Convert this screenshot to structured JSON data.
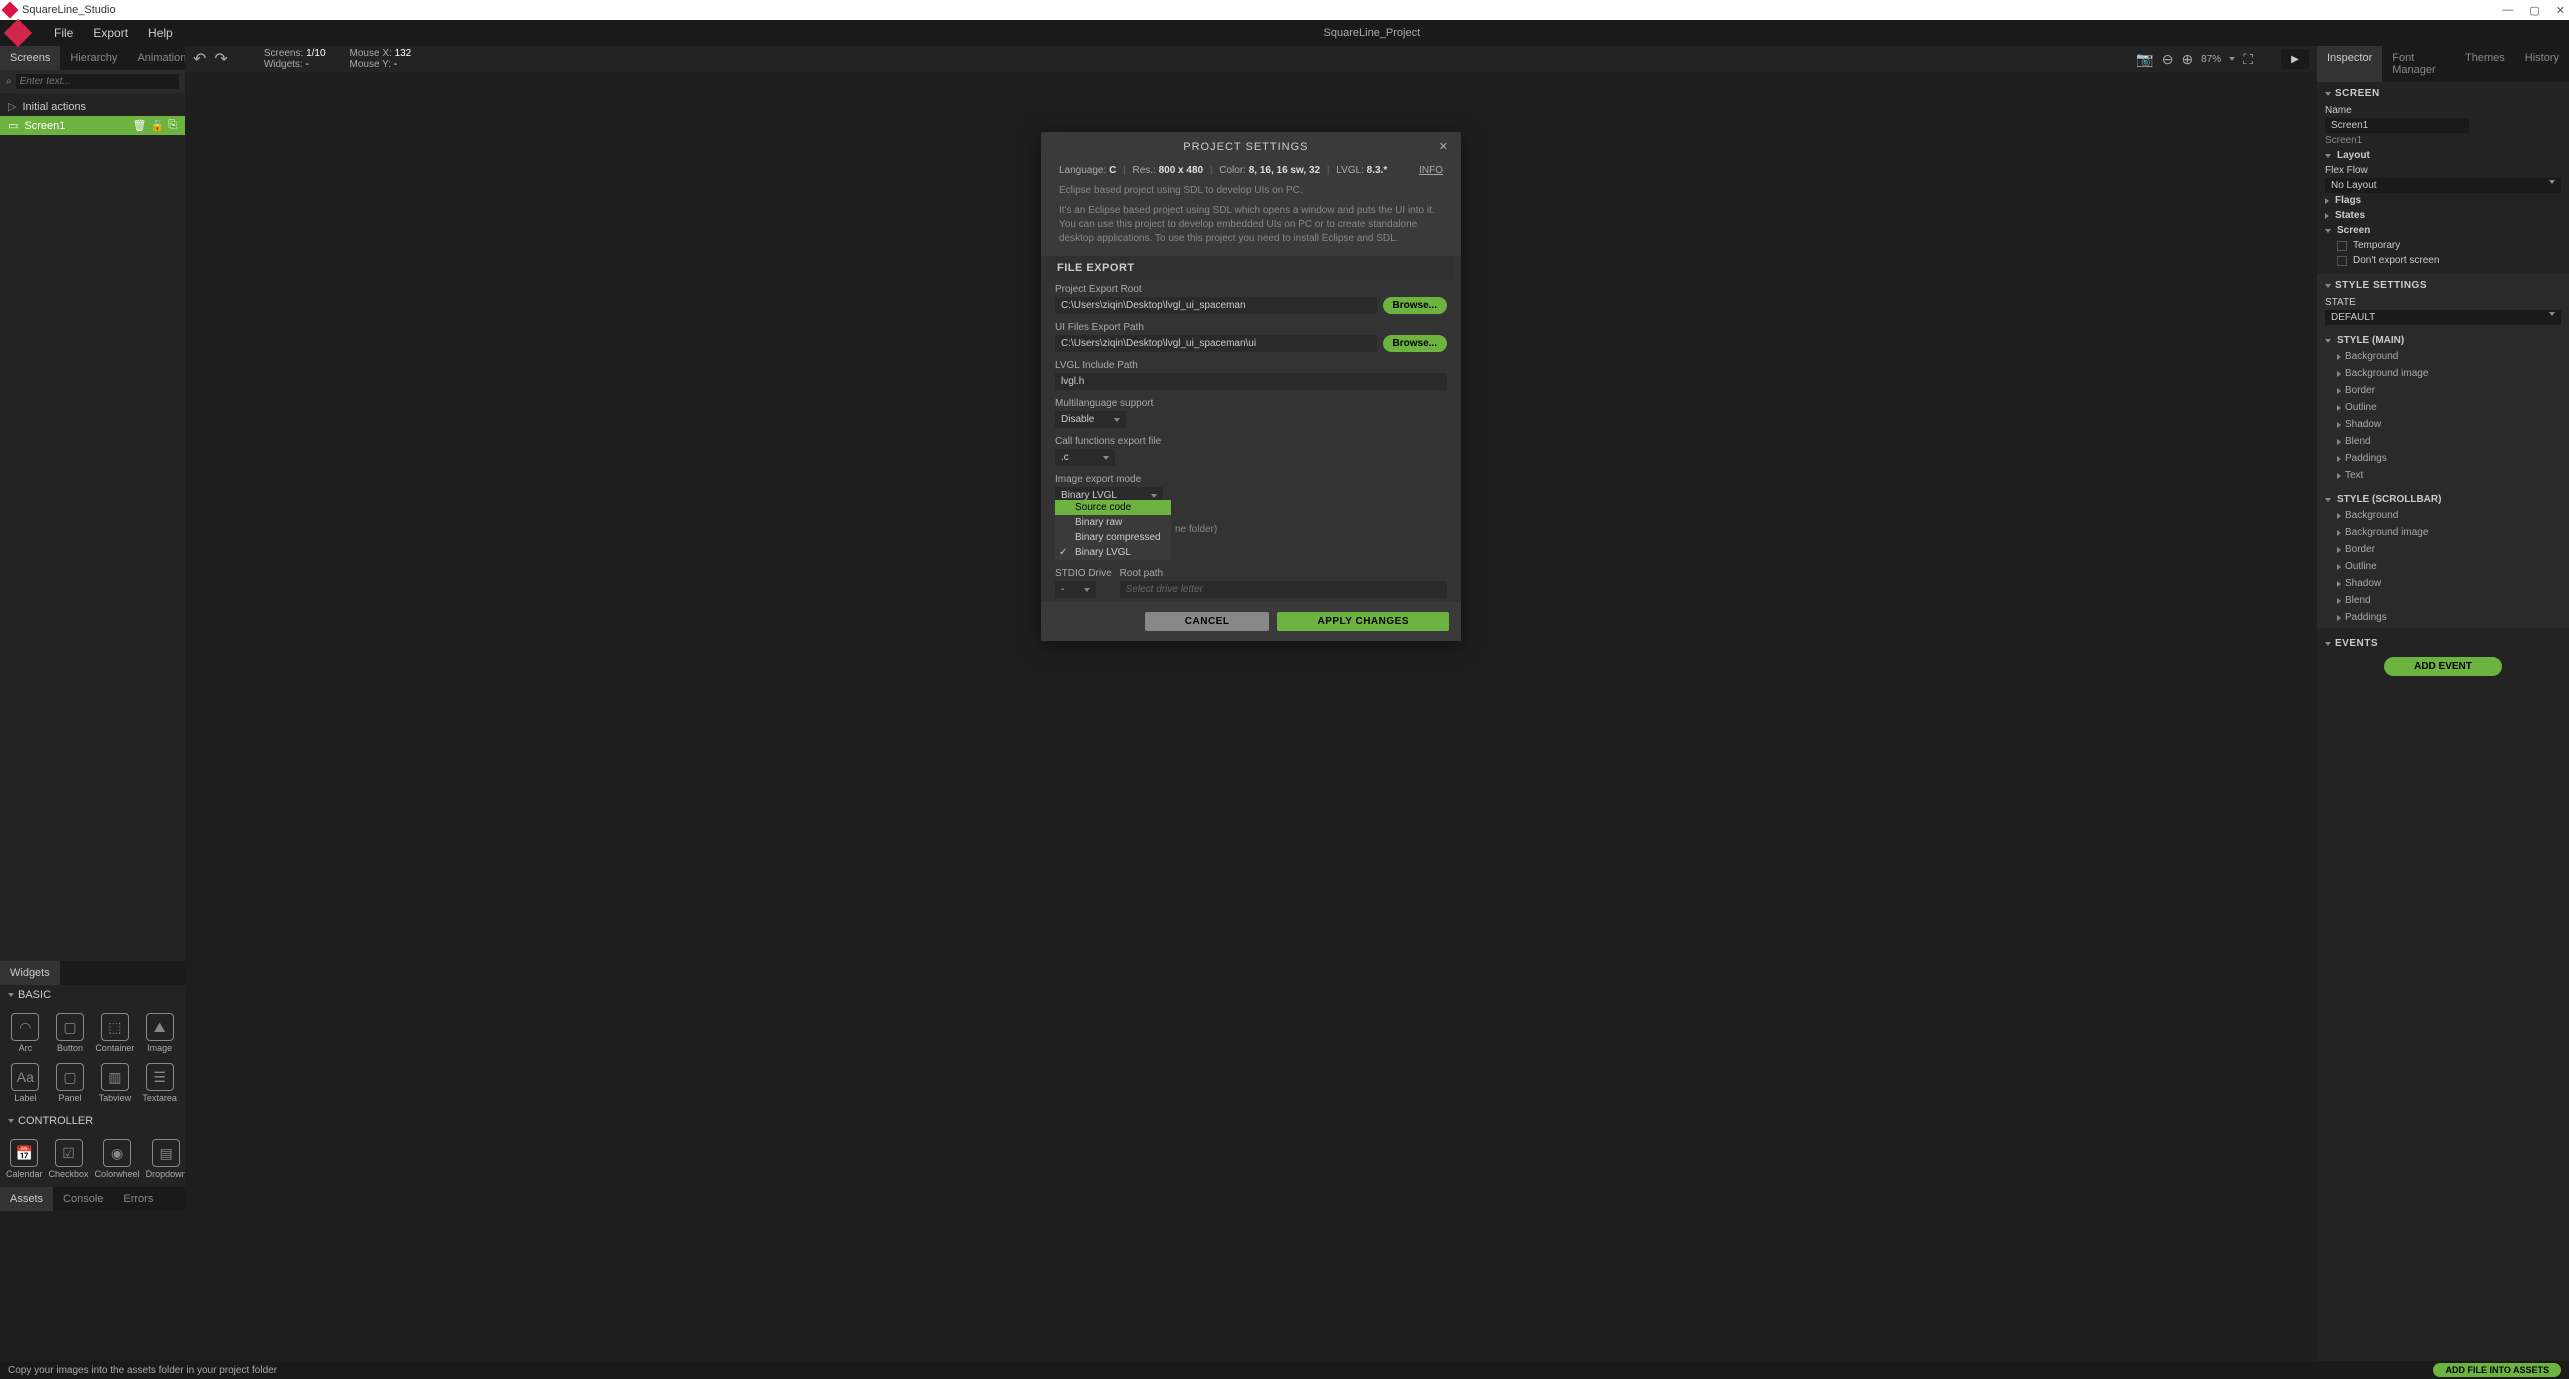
{
  "titlebar": {
    "app_name": "SquareLine_Studio"
  },
  "menubar": {
    "file": "File",
    "export": "Export",
    "help": "Help",
    "project_name": "SquareLine_Project"
  },
  "left_tabs": {
    "screens": "Screens",
    "hierarchy": "Hierarchy",
    "animation": "Animation"
  },
  "search": {
    "placeholder": "Enter text..."
  },
  "tree": {
    "initial_actions": "Initial actions",
    "screen1": "Screen1"
  },
  "toolbar": {
    "screens_label": "Screens:",
    "screens_value": "1/10",
    "widgets_label": "Widgets:",
    "widgets_value": "-",
    "mousex_label": "Mouse X:",
    "mousex_value": "132",
    "mousey_label": "Mouse Y:",
    "mousey_value": "-",
    "zoom": "87%"
  },
  "widgets_panel": {
    "title": "Widgets",
    "basic": "BASIC",
    "controller": "CONTROLLER",
    "basic_items": [
      "Arc",
      "Button",
      "Container",
      "Image",
      "Label",
      "Panel",
      "Tabview",
      "Textarea"
    ],
    "controller_items": [
      "Calendar",
      "Checkbox",
      "Colorwheel",
      "Dropdown"
    ]
  },
  "bottom_tabs": {
    "assets": "Assets",
    "console": "Console",
    "errors": "Errors"
  },
  "right_tabs": {
    "inspector": "Inspector",
    "font_manager": "Font Manager",
    "themes": "Themes",
    "history": "History"
  },
  "inspector": {
    "screen_header": "SCREEN",
    "name_label": "Name",
    "name_value": "Screen1",
    "screen_path": "Screen1",
    "layout_header": "Layout",
    "flexflow_label": "Flex Flow",
    "flexflow_value": "No Layout",
    "flags": "Flags",
    "states": "States",
    "screen": "Screen",
    "temporary": "Temporary",
    "dont_export": "Don't export screen",
    "style_settings": "STYLE SETTINGS",
    "state_label": "STATE",
    "state_value": "DEFAULT",
    "style_main": "STYLE (MAIN)",
    "style_scrollbar": "STYLE (SCROLLBAR)",
    "style_items": [
      "Background",
      "Background image",
      "Border",
      "Outline",
      "Shadow",
      "Blend",
      "Paddings",
      "Text"
    ],
    "style_scrollbar_items": [
      "Background",
      "Background image",
      "Border",
      "Outline",
      "Shadow",
      "Blend",
      "Paddings"
    ],
    "events": "EVENTS",
    "add_event": "ADD EVENT"
  },
  "modal": {
    "title": "PROJECT SETTINGS",
    "info": "INFO",
    "meta": {
      "lang_label": "Language:",
      "lang_value": "C",
      "res_label": "Res.:",
      "res_value": "800 x 480",
      "color_label": "Color:",
      "color_value": "8, 16, 16 sw, 32",
      "lvgl_label": "LVGL:",
      "lvgl_value": "8.3.*"
    },
    "desc1": "Eclipse based project using SDL to develop UIs on PC.",
    "desc2": "It's an Eclipse based project using SDL which opens a window and puts the UI into it. You can use this project to develop embedded UIs on PC or to create standalone desktop applications. To use this project you need to install Eclipse and SDL.",
    "file_export": "FILE EXPORT",
    "project_export_root_label": "Project Export Root",
    "project_export_root_value": "C:\\Users\\ziqin\\Desktop\\lvgl_ui_spaceman",
    "ui_files_label": "UI Files Export Path",
    "ui_files_value": "C:\\Users\\ziqin\\Desktop\\lvgl_ui_spaceman\\ui",
    "browse": "Browse...",
    "lvgl_include_label": "LVGL Include Path",
    "lvgl_include_value": "lvgl.h",
    "multilang_label": "Multilanguage support",
    "multilang_value": "Disable",
    "callfn_label": "Call functions export file",
    "callfn_value": ".c",
    "image_export_label": "Image export mode",
    "image_export_value": "Binary LVGL",
    "dropdown_options": [
      "Source code",
      "Binary raw",
      "Binary compressed",
      "Binary LVGL"
    ],
    "dropdown_highlighted": 0,
    "dropdown_selected": 3,
    "ne_folder_text": "ne folder)",
    "stdio_drive_label": "STDIO Drive",
    "root_path_label": "Root path",
    "stdio_drive_value": "-",
    "root_path_placeholder": "Select drive letter",
    "cancel": "CANCEL",
    "apply": "APPLY CHANGES"
  },
  "statusbar": {
    "tip": "Copy your images into the assets folder in your project folder",
    "add_file": "ADD FILE INTO ASSETS"
  }
}
